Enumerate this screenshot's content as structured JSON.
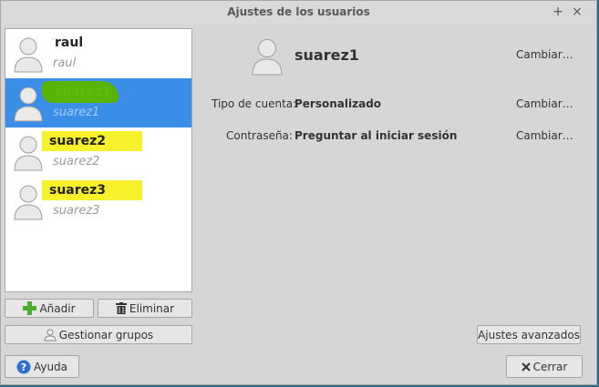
{
  "window": {
    "title": "Ajustes de los usuarios",
    "plus_glyph": "+",
    "close_glyph": "×"
  },
  "users": [
    {
      "name": "raul",
      "username": "raul",
      "selected": false,
      "highlight": "none"
    },
    {
      "name": "suarez1",
      "username": "suarez1",
      "selected": true,
      "highlight": "green"
    },
    {
      "name": "suarez2",
      "username": "suarez2",
      "selected": false,
      "highlight": "yellow"
    },
    {
      "name": "suarez3",
      "username": "suarez3",
      "selected": false,
      "highlight": "yellow"
    }
  ],
  "detail": {
    "name": "suarez1",
    "change_name": "Cambiar…",
    "account_type_label": "Tipo de cuenta:",
    "account_type_value": "Personalizado",
    "change_account_type": "Cambiar…",
    "password_label": "Contraseña:",
    "password_value": "Preguntar al iniciar sesión",
    "change_password": "Cambiar…"
  },
  "buttons": {
    "add": "Añadir",
    "remove": "Eliminar",
    "manage_groups": "Gestionar grupos",
    "advanced": "Ajustes avanzados",
    "help": "Ayuda",
    "close": "Cerrar"
  },
  "icons": {
    "user": "user-avatar-icon",
    "add": "plus-icon",
    "remove": "trash-icon",
    "groups": "group-icon",
    "help": "help-icon",
    "close": "close-icon"
  },
  "colors": {
    "selection": "#3b8ee8",
    "highlight_yellow": "#f7f12b",
    "highlight_green": "#57b400",
    "add_icon": "#4caf2b",
    "help_icon": "#2f6fd2"
  }
}
